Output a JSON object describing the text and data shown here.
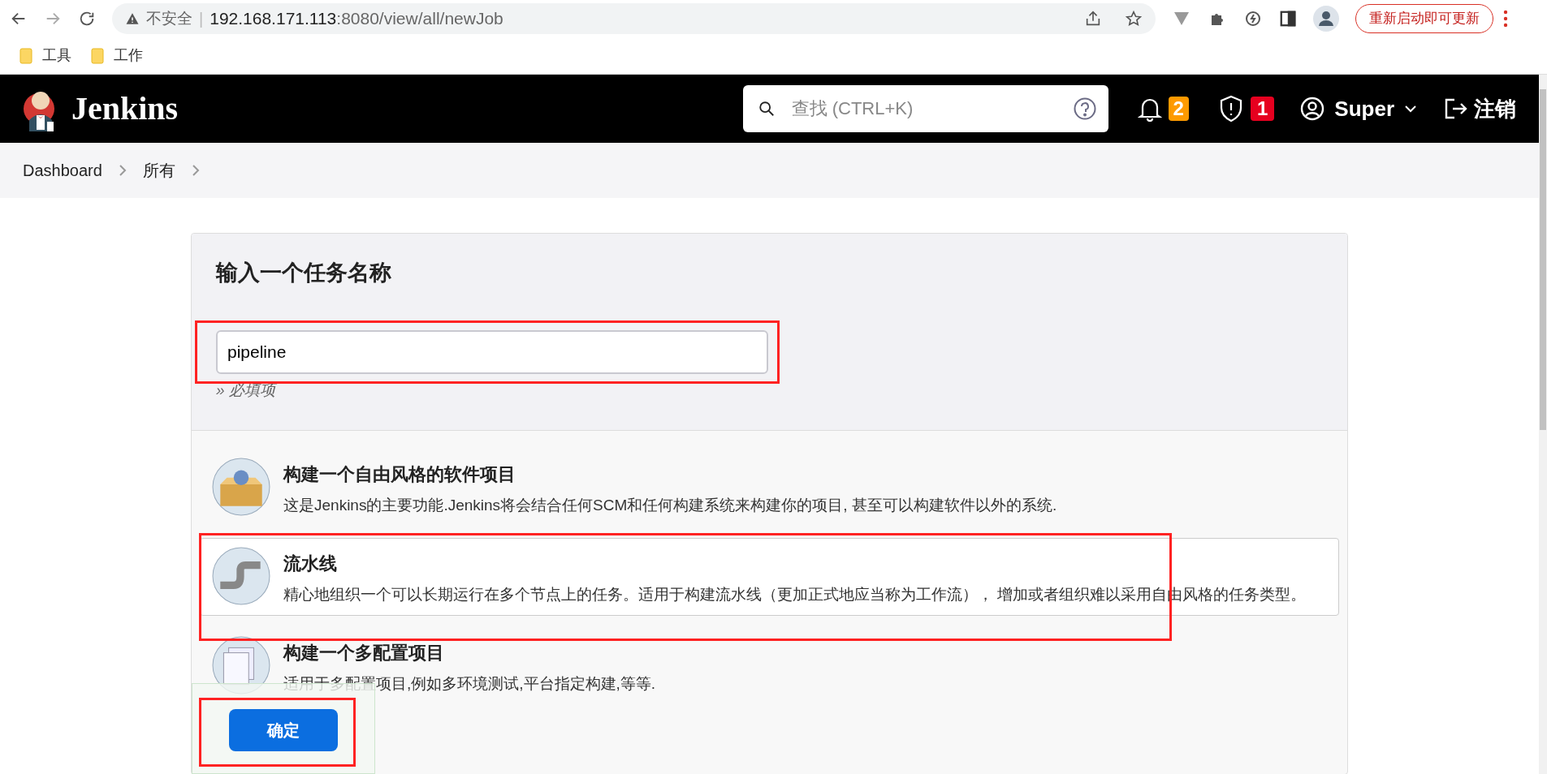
{
  "browser": {
    "security_label": "不安全",
    "separator": "|",
    "url_host": "192.168.171.113",
    "url_rest": ":8080/view/all/newJob",
    "update_button": "重新启动即可更新"
  },
  "bookmarks": [
    {
      "label": "工具"
    },
    {
      "label": "工作"
    }
  ],
  "header": {
    "brand": "Jenkins",
    "search_placeholder": "查找 (CTRL+K)",
    "notifications": "2",
    "security_alerts": "1",
    "user": "Super",
    "logout": "注销"
  },
  "breadcrumbs": [
    {
      "label": "Dashboard"
    },
    {
      "label": "所有"
    }
  ],
  "form": {
    "heading": "输入一个任务名称",
    "name_value": "pipeline",
    "required_hint": "» 必填项"
  },
  "job_types": [
    {
      "kind": "box",
      "title": "构建一个自由风格的软件项目",
      "description": "这是Jenkins的主要功能.Jenkins将会结合任何SCM和任何构建系统来构建你的项目, 甚至可以构建软件以外的系统.",
      "selected": false
    },
    {
      "kind": "pipe",
      "title": "流水线",
      "description": "精心地组织一个可以长期运行在多个节点上的任务。适用于构建流水线（更加正式地应当称为工作流）， 增加或者组织难以采用自由风格的任务类型。",
      "selected": true
    },
    {
      "kind": "stack",
      "title": "构建一个多配置项目",
      "description": "适用于多配置项目,例如多环境测试,平台指定构建,等等.",
      "selected": false
    }
  ],
  "ok_button": "确定"
}
